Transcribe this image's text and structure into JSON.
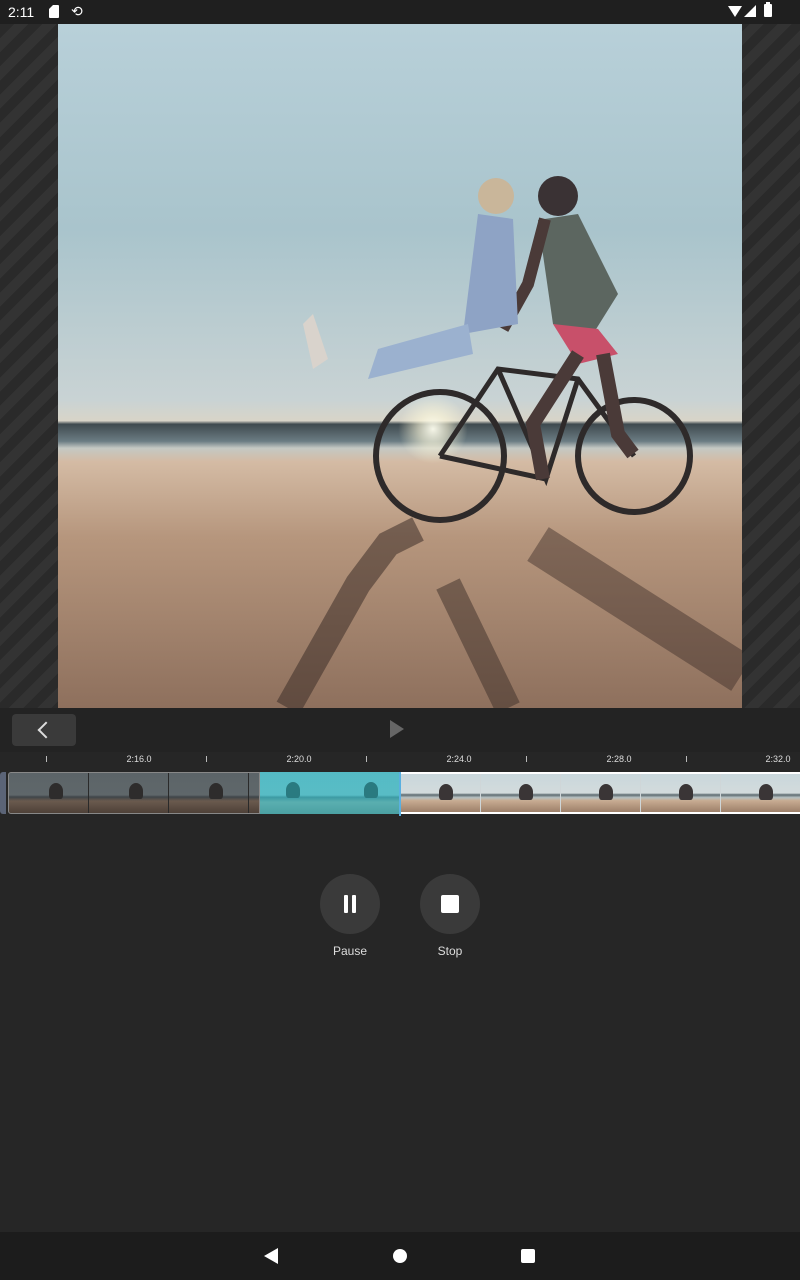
{
  "status_bar": {
    "time": "2:11",
    "icons": [
      "sd-card-icon",
      "sync-icon",
      "wifi-icon",
      "signal-icon",
      "battery-icon"
    ]
  },
  "preview": {
    "image_description_icon": "video-frame"
  },
  "toolbar": {
    "back_icon": "chevron-left-icon",
    "play_icon": "play-icon"
  },
  "timeline": {
    "ticks": [
      "2:16.0",
      "2:20.0",
      "2:24.0",
      "2:28.0",
      "2:32.0"
    ],
    "colors": {
      "selection": "#3cbec8",
      "playhead": "#5ab0e0"
    }
  },
  "controls": {
    "pause_label": "Pause",
    "stop_label": "Stop"
  },
  "nav_bar": {
    "icons": [
      "nav-back-icon",
      "nav-home-icon",
      "nav-recents-icon"
    ]
  }
}
